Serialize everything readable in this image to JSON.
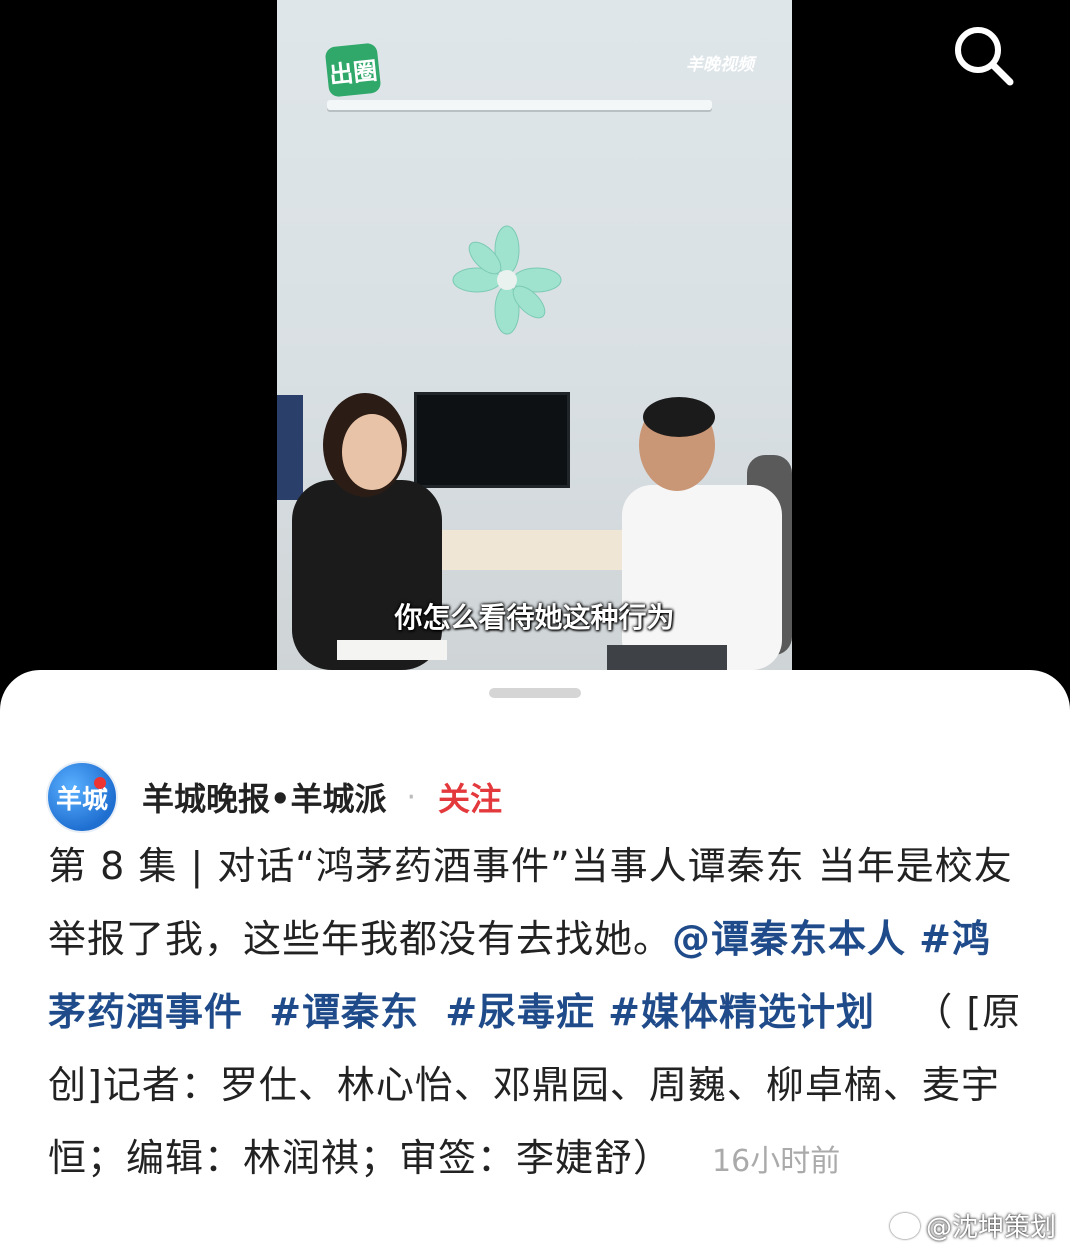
{
  "video": {
    "logo_left": "出圈",
    "logo_right": "羊晚视频",
    "subtitle": "你怎么看待她这种行为"
  },
  "search": {
    "icon": "search-icon"
  },
  "author": {
    "avatar_text": "羊城",
    "name": "羊城晚报•羊城派",
    "separator": "·",
    "follow_label": "关注"
  },
  "post": {
    "text_plain_1": "第 8 集 | 对话“鸿茅药酒事件”当事人谭秦东 当年是校友举报了我，这些年我都没有去找她。",
    "mention": "@谭秦东本人",
    "tags": [
      "#鸿茅药酒事件",
      "#谭秦东",
      "#尿毒症",
      "#媒体精选计划"
    ],
    "text_plain_2": "（ [原创]记者：罗仕、林心怡、邓鼎园、周巍、柳卓楠、麦宇恒；编辑：林润祺；审签：李婕舒）",
    "time": "16小时前"
  },
  "watermark": "@沈坤策划"
}
